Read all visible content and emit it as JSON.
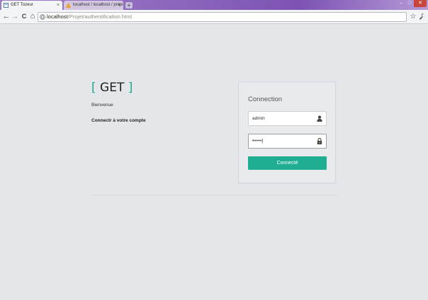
{
  "browser": {
    "tabs": [
      {
        "label": "GET Tozeur",
        "active": true,
        "icon": "page-favicon"
      },
      {
        "label": "localhost / localhost / proje",
        "active": false,
        "icon": "phpmyadmin-favicon"
      }
    ],
    "new_tab_label": "+",
    "close_tab_label": "×",
    "url_host": "localhost",
    "url_path": "/Projet/authentification.html",
    "controls": {
      "back": "←",
      "forward": "→",
      "reload": "C",
      "home": "⌂",
      "star": "☆",
      "wrench": "wrench-icon"
    }
  },
  "page": {
    "brand": {
      "open": "[",
      "name": "GET",
      "close": "]"
    },
    "welcome": "Bienvenue",
    "subtitle": "Connectr à votre compte"
  },
  "login": {
    "title": "Connection",
    "username": {
      "value": "admin",
      "icon": "user-icon"
    },
    "password": {
      "value": "•••••|",
      "icon": "lock-icon"
    },
    "submit_label": "Connecté"
  },
  "colors": {
    "accent": "#1fae92",
    "page_bg": "#e4e6e9"
  }
}
